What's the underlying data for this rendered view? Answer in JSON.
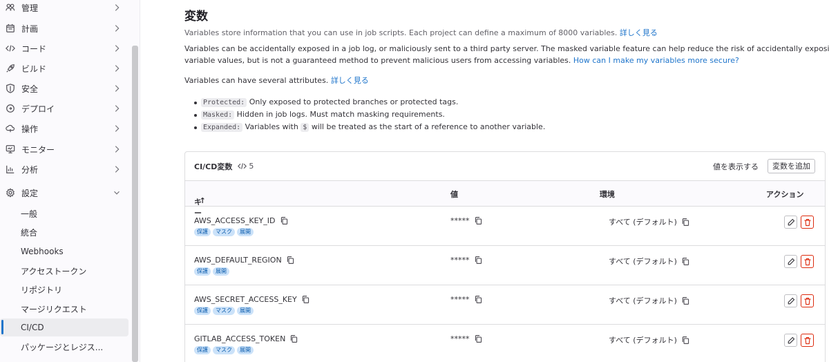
{
  "sidebar": {
    "items": [
      {
        "label": "管理",
        "icon": "users-icon"
      },
      {
        "label": "計画",
        "icon": "calendar-icon"
      },
      {
        "label": "コード",
        "icon": "code-icon"
      },
      {
        "label": "ビルド",
        "icon": "rocket-icon"
      },
      {
        "label": "安全",
        "icon": "shield-icon"
      },
      {
        "label": "デプロイ",
        "icon": "deploy-icon"
      },
      {
        "label": "操作",
        "icon": "cloud-icon"
      },
      {
        "label": "モニター",
        "icon": "monitor-icon"
      },
      {
        "label": "分析",
        "icon": "chart-icon"
      },
      {
        "label": "設定",
        "icon": "settings-icon"
      }
    ],
    "settings_sub": [
      "一般",
      "統合",
      "Webhooks",
      "アクセストークン",
      "リポジトリ",
      "マージリクエスト",
      "CI/CD",
      "パッケージとレジス..."
    ],
    "active_sub": "CI/CD"
  },
  "main": {
    "title": "変数",
    "intro": "Variables store information that you can use in job scripts. Each project can define a maximum of 8000 variables. ",
    "intro_link": "詳しく見る",
    "warning_line1": "Variables can be accidentally exposed in a job log, or maliciously sent to a third party server. The masked variable feature can help reduce the risk of accidentally exposing",
    "warning_line2": "variable values, but is not a guaranteed method to prevent malicious users from accessing variables. ",
    "warning_link": "How can I make my variables more secure?",
    "attrs_text": "Variables can have several attributes. ",
    "attrs_link": "詳しく見る",
    "bullets": [
      {
        "code": "Protected:",
        "text": " Only exposed to protected branches or protected tags."
      },
      {
        "code": "Masked:",
        "text": " Hidden in job logs. Must match masking requirements."
      },
      {
        "code": "Expanded:",
        "text_pre": " Variables with ",
        "code2": "$",
        "text": " will be treated as the start of a reference to another variable."
      }
    ]
  },
  "card": {
    "title": "CI/CD変数",
    "count": "5",
    "reveal_label": "値を表示する",
    "add_label": "変数を追加",
    "columns": {
      "key": "キー",
      "value": "値",
      "env": "環境",
      "actions": "アクション"
    },
    "sort_indicator": "↑",
    "rows": [
      {
        "key": "AWS_ACCESS_KEY_ID",
        "value": "*****",
        "env": "すべて (デフォルト)",
        "badges": [
          "保護",
          "マスク",
          "展開"
        ]
      },
      {
        "key": "AWS_DEFAULT_REGION",
        "value": "*****",
        "env": "すべて (デフォルト)",
        "badges": [
          "保護",
          "展開"
        ]
      },
      {
        "key": "AWS_SECRET_ACCESS_KEY",
        "value": "*****",
        "env": "すべて (デフォルト)",
        "badges": [
          "保護",
          "マスク",
          "展開"
        ]
      },
      {
        "key": "GITLAB_ACCESS_TOKEN",
        "value": "*****",
        "env": "すべて (デフォルト)",
        "badges": [
          "保護",
          "マスク",
          "展開"
        ]
      }
    ]
  },
  "colors": {
    "accent": "#1f75cb",
    "danger": "#dd2b0e",
    "badge_bg": "#cbe2f9"
  }
}
